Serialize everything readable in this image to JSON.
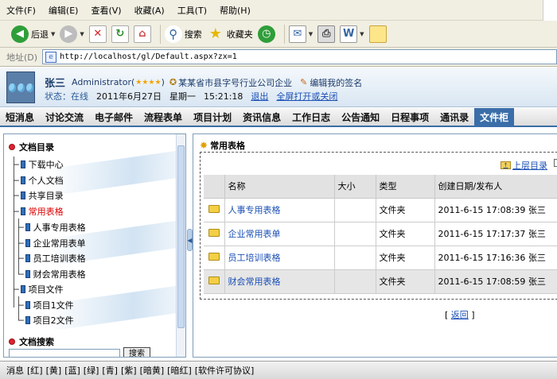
{
  "menubar": {
    "items": [
      "文件(F)",
      "编辑(E)",
      "查看(V)",
      "收藏(A)",
      "工具(T)",
      "帮助(H)"
    ]
  },
  "toolbar": {
    "back_label": "后退",
    "search_label": "搜索",
    "favorites_label": "收藏夹"
  },
  "address": {
    "label": "地址(D)",
    "url": "http://localhost/gl/Default.aspx?zx=1"
  },
  "header": {
    "username": "张三",
    "role_prefix": "Administrator(",
    "role_stars": "★★★★",
    "role_suffix": ")",
    "company": "某某省市县字号行业公司企业",
    "edit_signature": "编辑我的签名",
    "status_label": "状态：",
    "status_value": "在线",
    "date": "2011年6月27日",
    "weekday": "星期一",
    "time": "15:21:18",
    "logout": "退出",
    "fullscreen": "全屏打开或关闭"
  },
  "nav": {
    "items": [
      "短消息",
      "讨论交流",
      "电子邮件",
      "流程表单",
      "项目计划",
      "资讯信息",
      "工作日志",
      "公告通知",
      "日程事项",
      "通讯录",
      "文件柜"
    ],
    "active": "文件柜"
  },
  "sidebar": {
    "title": "文档目录",
    "items": [
      "下载中心",
      "个人文档",
      "共享目录",
      "常用表格",
      "人事专用表格",
      "企业常用表单",
      "员工培训表格",
      "财会常用表格",
      "项目文件",
      "项目1文件",
      "项目2文件"
    ],
    "active_item": "常用表格",
    "search_title": "文档搜索",
    "search_button": "搜索"
  },
  "main": {
    "title": "常用表格",
    "up_link": "上层目录",
    "columns": [
      "名称",
      "大小",
      "类型",
      "创建日期/发布人"
    ],
    "rows": [
      {
        "name": "人事专用表格",
        "size": "",
        "type": "文件夹",
        "created": "2011-6-15 17:08:39 张三"
      },
      {
        "name": "企业常用表单",
        "size": "",
        "type": "文件夹",
        "created": "2011-6-15 17:17:37 张三"
      },
      {
        "name": "员工培训表格",
        "size": "",
        "type": "文件夹",
        "created": "2011-6-15 17:16:36 张三"
      },
      {
        "name": "财会常用表格",
        "size": "",
        "type": "文件夹",
        "created": "2011-6-15 17:08:59 张三"
      }
    ],
    "back_open": "[",
    "back_link": "返回",
    "back_close": "]"
  },
  "footer": {
    "items": [
      "消息",
      "[红]",
      "[黄]",
      "[蓝]",
      "[绿]",
      "[青]",
      "[紫]",
      "[暗黄]",
      "[暗红]",
      "[软件许可协议]"
    ]
  },
  "colors": {
    "nav_active": "#3a6ea8",
    "link": "#1a4fb5",
    "active_tree": "#dd0000",
    "header_text": "#1c3b6c"
  }
}
